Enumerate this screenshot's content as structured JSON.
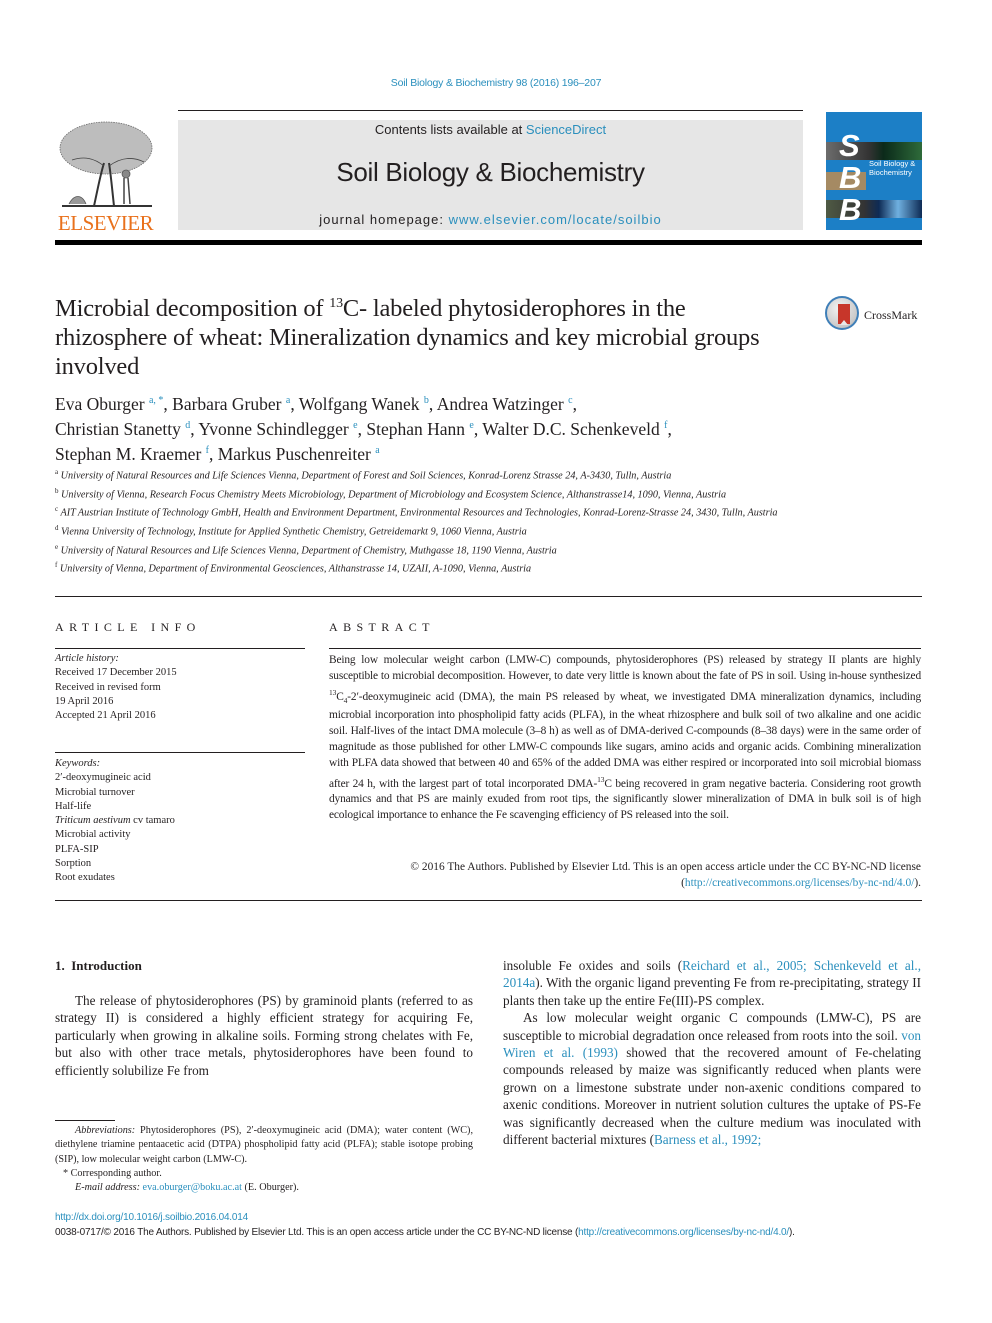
{
  "header": {
    "citation": "Soil Biology & Biochemistry 98 (2016) 196–207",
    "contents_prefix": "Contents lists available at ",
    "contents_link": "ScienceDirect",
    "journal_name": "Soil Biology & Biochemistry",
    "homepage_prefix": "journal homepage: ",
    "homepage_link": "www.elsevier.com/locate/soilbio",
    "publisher_logo_text": "ELSEVIER",
    "cover": {
      "letters": [
        "S",
        "B",
        "B"
      ],
      "title_line1": "Soil Biology &",
      "title_line2": "Biochemistry"
    },
    "crossmark_label": "CrossMark"
  },
  "article": {
    "title_part1": "Microbial decomposition of ",
    "title_sup": "13",
    "title_part2": "C- labeled phytosiderophores in the rhizosphere of wheat: Mineralization dynamics and key microbial groups involved",
    "authors": [
      {
        "name": "Eva Oburger",
        "aff": "a, *"
      },
      {
        "name": "Barbara Gruber",
        "aff": "a"
      },
      {
        "name": "Wolfgang Wanek",
        "aff": "b"
      },
      {
        "name": "Andrea Watzinger",
        "aff": "c"
      },
      {
        "name": "Christian Stanetty",
        "aff": "d"
      },
      {
        "name": "Yvonne Schindlegger",
        "aff": "e"
      },
      {
        "name": "Stephan Hann",
        "aff": "e"
      },
      {
        "name": "Walter D.C. Schenkeveld",
        "aff": "f"
      },
      {
        "name": "Stephan M. Kraemer",
        "aff": "f"
      },
      {
        "name": "Markus Puschenreiter",
        "aff": "a"
      }
    ],
    "affiliations": [
      {
        "key": "a",
        "text": "University of Natural Resources and Life Sciences Vienna, Department of Forest and Soil Sciences, Konrad-Lorenz Strasse 24, A-3430, Tulln, Austria"
      },
      {
        "key": "b",
        "text": "University of Vienna, Research Focus Chemistry Meets Microbiology, Department of Microbiology and Ecosystem Science, Althanstrasse14, 1090, Vienna, Austria"
      },
      {
        "key": "c",
        "text": "AIT Austrian Institute of Technology GmbH, Health and Environment Department, Environmental Resources and Technologies, Konrad-Lorenz-Strasse 24, 3430, Tulln, Austria"
      },
      {
        "key": "d",
        "text": "Vienna University of Technology, Institute for Applied Synthetic Chemistry, Getreidemarkt 9, 1060 Vienna, Austria"
      },
      {
        "key": "e",
        "text": "University of Natural Resources and Life Sciences Vienna, Department of Chemistry, Muthgasse 18, 1190 Vienna, Austria"
      },
      {
        "key": "f",
        "text": "University of Vienna, Department of Environmental Geosciences, Althanstrasse 14, UZAII, A-1090, Vienna, Austria"
      }
    ]
  },
  "article_info": {
    "heading": "ARTICLE INFO",
    "history_label": "Article history:",
    "history": [
      "Received 17 December 2015",
      "Received in revised form",
      "19 April 2016",
      "Accepted 21 April 2016"
    ],
    "keywords_label": "Keywords:",
    "keywords": [
      "2′-deoxymugineic acid",
      "Microbial turnover",
      "Half-life",
      "Triticum aestivum cv tamaro",
      "Microbial activity",
      "PLFA-SIP",
      "Sorption",
      "Root exudates"
    ]
  },
  "abstract": {
    "heading": "ABSTRACT",
    "part1": "Being low molecular weight carbon (LMW-C) compounds, phytosiderophores (PS) released by strategy II plants are highly susceptible to microbial decomposition. However, to date very little is known about the fate of PS in soil. Using in-house synthesized ",
    "sup1": "13",
    "part2": "C",
    "sub1": "4",
    "part3": "-2′-deoxymugineic acid (DMA), the main PS released by wheat, we investigated DMA mineralization dynamics, including microbial incorporation into phospholipid fatty acids (PLFA), in the wheat rhizosphere and bulk soil of two alkaline and one acidic soil. Half-lives of the intact DMA molecule (3–8 h) as well as of DMA-derived C-compounds (8–38 days) were in the same order of magnitude as those published for other LMW-C compounds like sugars, amino acids and organic acids. Combining mineralization with PLFA data showed that between 40 and 65% of the added DMA was either respired or incorporated into soil microbial biomass after 24 h, with the largest part of total incorporated DMA-",
    "sup2": "13",
    "part4": "C being recovered in gram negative bacteria. Considering root growth dynamics and that PS are mainly exuded from root tips, the significantly slower mineralization of DMA in bulk soil is of high ecological importance to enhance the Fe scavenging efficiency of PS released into the soil.",
    "copyright_text": "© 2016 The Authors. Published by Elsevier Ltd. This is an open access article under the CC BY-NC-ND license (",
    "copyright_link": "http://creativecommons.org/licenses/by-nc-nd/4.0/",
    "copyright_end": ")."
  },
  "introduction": {
    "heading": "1.  Introduction",
    "left_p1": "The release of phytosiderophores (PS) by graminoid plants (referred to as strategy II) is considered a highly efficient strategy for acquiring Fe, particularly when growing in alkaline soils. Forming strong chelates with Fe, but also with other trace metals, phytosiderophores have been found to efficiently solubilize Fe from",
    "right_p1_a": "insoluble Fe oxides and soils (",
    "right_p1_ref": "Reichard et al., 2005; Schenkeveld et al., 2014a",
    "right_p1_b": "). With the organic ligand preventing Fe from re-precipitating, strategy II plants then take up the entire Fe(III)-PS complex.",
    "right_p2_a": "As low molecular weight organic C compounds (LMW-C), PS are susceptible to microbial degradation once released from roots into the soil. ",
    "right_p2_ref": "von Wiren et al. (1993)",
    "right_p2_b": " showed that the recovered amount of Fe-chelating compounds released by maize was significantly reduced when plants were grown on a limestone substrate under non-axenic conditions compared to axenic conditions. Moreover in nutrient solution cultures the uptake of PS-Fe was significantly decreased when the culture medium was inoculated with different bacterial mixtures (",
    "right_p2_ref2": "Barness et al., 1992;"
  },
  "footnotes": {
    "abbrev_label": "Abbreviations:",
    "abbrev_text": " Phytosiderophores (PS), 2′-deoxymugineic acid (DMA); water content (WC), diethylene triamine pentaacetic acid (DTPA) phospholipid fatty acid (PLFA); stable isotope probing (SIP), low molecular weight carbon (LMW-C).",
    "corresponding": "* Corresponding author.",
    "email_label": "E-mail address:",
    "email": "eva.oburger@boku.ac.at",
    "email_suffix": " (E. Oburger)."
  },
  "footer": {
    "doi": "http://dx.doi.org/10.1016/j.soilbio.2016.04.014",
    "issn_text": "0038-0717/© 2016 The Authors. Published by Elsevier Ltd. This is an open access article under the CC BY-NC-ND license (",
    "issn_link": "http://creativecommons.org/licenses/by-nc-nd/4.0/",
    "issn_end": ")."
  },
  "colors": {
    "link": "#2a8fbd",
    "elsevier_orange": "#e9711c",
    "cover_blue": "#1c7fc6",
    "banner_gray": "#e6e6e6",
    "crossmark_red": "#c7362a"
  }
}
